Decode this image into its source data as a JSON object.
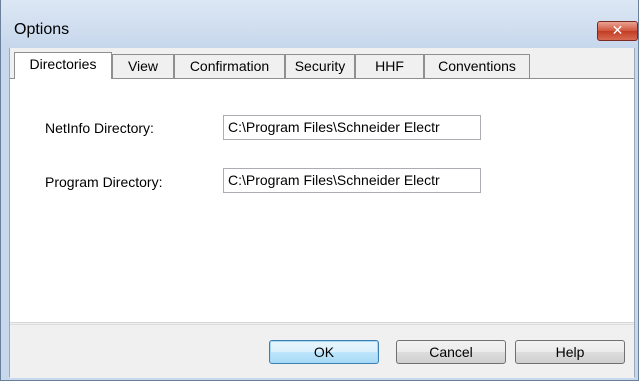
{
  "window": {
    "title": "Options",
    "close_glyph": "✕"
  },
  "tabs": [
    {
      "label": "Directories",
      "active": true
    },
    {
      "label": "View",
      "active": false
    },
    {
      "label": "Confirmation",
      "active": false
    },
    {
      "label": "Security",
      "active": false
    },
    {
      "label": "HHF",
      "active": false
    },
    {
      "label": "Conventions",
      "active": false
    }
  ],
  "fields": {
    "netinfo": {
      "label": "NetInfo Directory:",
      "value": "C:\\Program Files\\Schneider Electr"
    },
    "program": {
      "label": "Program Directory:",
      "value": "C:\\Program Files\\Schneider Electr"
    }
  },
  "buttons": {
    "ok": "OK",
    "cancel": "Cancel",
    "help": "Help"
  },
  "colors": {
    "titlebar": "#c7d7ec",
    "close": "#c23d22",
    "panel": "#ffffff",
    "chrome": "#f0f0f0",
    "default_button_border": "#3c7fb1"
  },
  "icons": {
    "close": "close-icon"
  }
}
